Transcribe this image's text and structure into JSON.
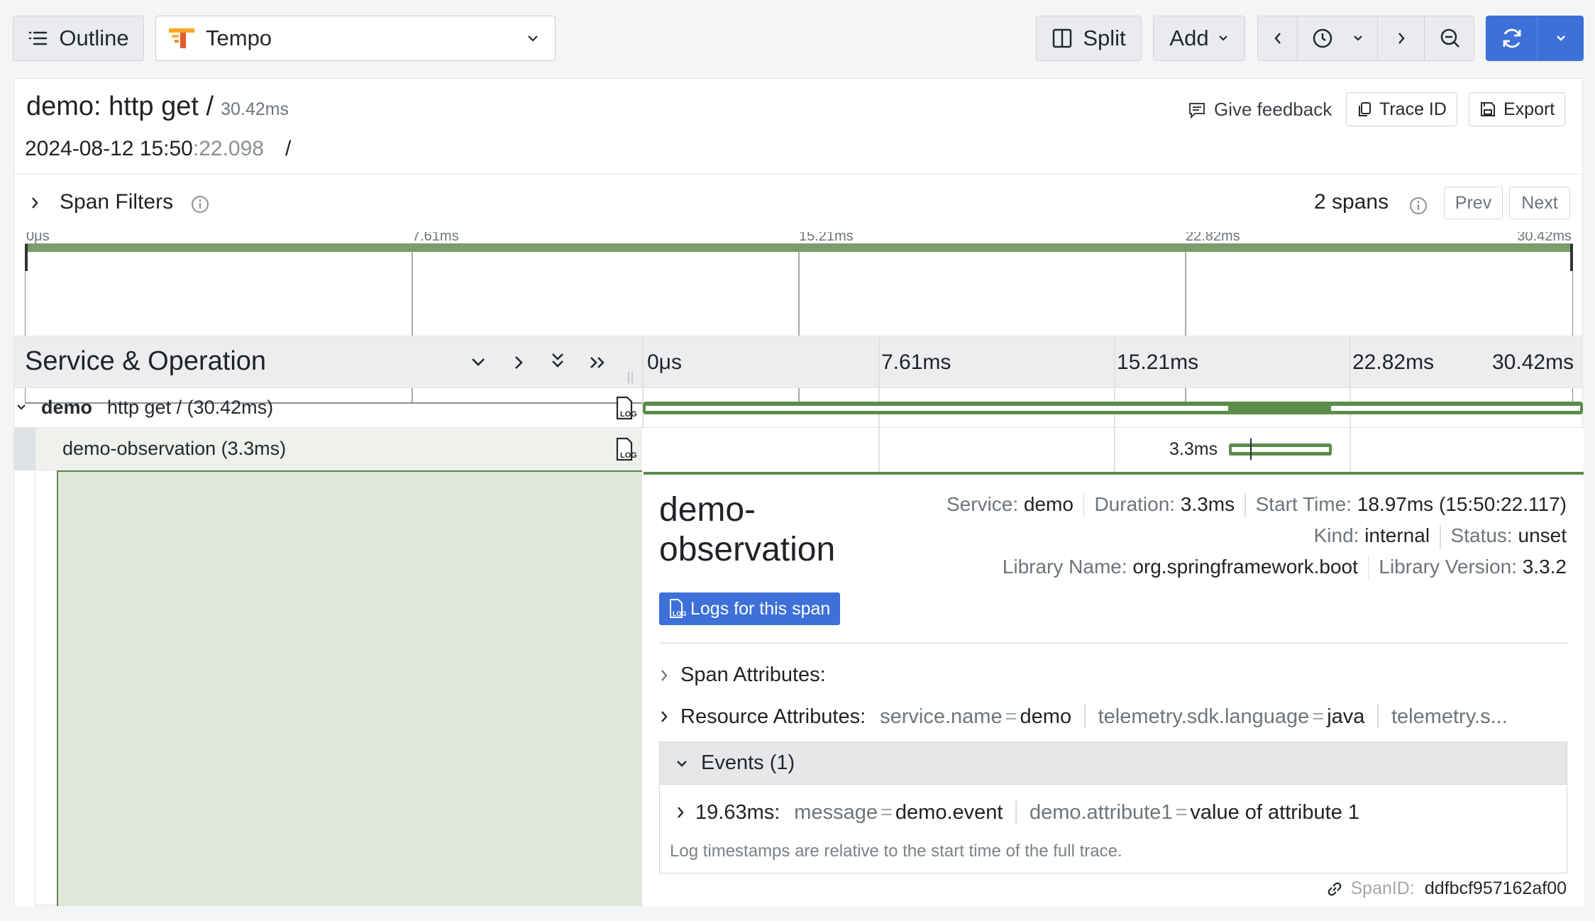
{
  "toolbar": {
    "outline_label": "Outline",
    "datasource": "Tempo",
    "split_label": "Split",
    "add_label": "Add"
  },
  "trace": {
    "title": "demo: http get /",
    "duration": "30.42ms",
    "date_main": "2024-08-12 15:50",
    "date_ms": ":22.098",
    "date_slash": "/",
    "feedback": "Give feedback",
    "trace_id_label": "Trace ID",
    "export_label": "Export"
  },
  "filters": {
    "label": "Span Filters",
    "span_count": "2 spans",
    "prev": "Prev",
    "next": "Next"
  },
  "minimap": {
    "ticks": [
      "0μs",
      "7.61ms",
      "15.21ms",
      "22.82ms",
      "30.42ms"
    ]
  },
  "timeline": {
    "column_title": "Service & Operation",
    "ticks": [
      "0μs",
      "7.61ms",
      "15.21ms",
      "22.82ms",
      "30.42ms"
    ],
    "rows": [
      {
        "service": "demo",
        "operation": "http get / (30.42ms)"
      },
      {
        "service": "",
        "operation": "demo-observation (3.3ms)",
        "bar_label": "3.3ms"
      }
    ]
  },
  "detail": {
    "title_line1": "demo-",
    "title_line2": "observation",
    "service_label": "Service:",
    "service": "demo",
    "duration_label": "Duration:",
    "duration": "3.3ms",
    "start_label": "Start Time:",
    "start": "18.97ms (15:50:22.117)",
    "kind_label": "Kind:",
    "kind": "internal",
    "status_label": "Status:",
    "status": "unset",
    "lib_name_label": "Library Name:",
    "lib_name": "org.springframework.boot",
    "lib_version_label": "Library Version:",
    "lib_version": "3.3.2",
    "logs_button": "Logs for this span",
    "span_attributes": "Span Attributes:",
    "resource_attributes": "Resource Attributes:",
    "resource": [
      {
        "key": "service.name",
        "value": "demo"
      },
      {
        "key": "telemetry.sdk.language",
        "value": "java"
      },
      {
        "key": "telemetry.s...",
        "value": ""
      }
    ],
    "events_label": "Events (1)",
    "event_time": "19.63ms:",
    "event_attrs": [
      {
        "key": "message",
        "value": "demo.event"
      },
      {
        "key": "demo.attribute1",
        "value": "value of attribute 1"
      }
    ],
    "events_note": "Log timestamps are relative to the start time of the full trace.",
    "span_id_label": "SpanID:",
    "span_id": "ddfbcf957162af00"
  },
  "colors": {
    "accent": "#3d71d9",
    "span_green": "#5b8c48",
    "span_light": "#dfe6da"
  }
}
